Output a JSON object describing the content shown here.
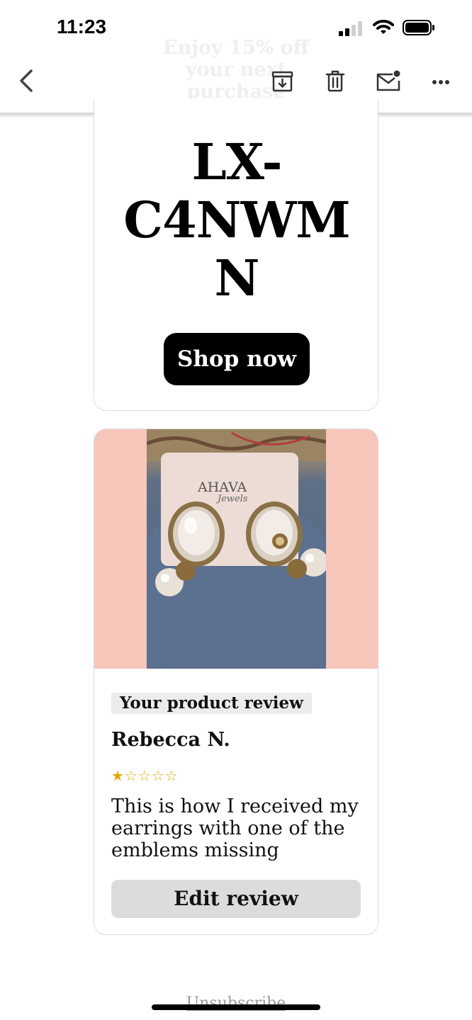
{
  "status_bar": {
    "time": "11:23",
    "signal_icon": "cellular-signal-icon",
    "wifi_icon": "wifi-icon",
    "battery_icon": "battery-icon"
  },
  "email": {
    "preheader": "Enjoy 15% off your next purchase"
  },
  "toolbar": {
    "back_icon": "chevron-left-icon",
    "archive_icon": "archive-icon",
    "delete_icon": "trash-icon",
    "mark_unread_icon": "mail-unread-icon",
    "more_icon": "more-icon"
  },
  "promo": {
    "code": "LX-C4NWMN",
    "code_lines": [
      "LX-",
      "C4NWM",
      "N"
    ],
    "shop_button": "Shop now"
  },
  "review": {
    "photo_brand": "AHAVA",
    "photo_brand_script": "Jewels",
    "tag": "Your product review",
    "reviewer": "Rebecca N.",
    "rating": 1,
    "rating_max": 5,
    "text": "This is how I received my earrings with one of the emblems missing",
    "edit_button": "Edit review"
  },
  "footer": {
    "unsubscribe": "Unsubscribe"
  },
  "colors": {
    "photo_background": "#f6c6bb",
    "star": "#e5a800",
    "button": "#000000"
  }
}
